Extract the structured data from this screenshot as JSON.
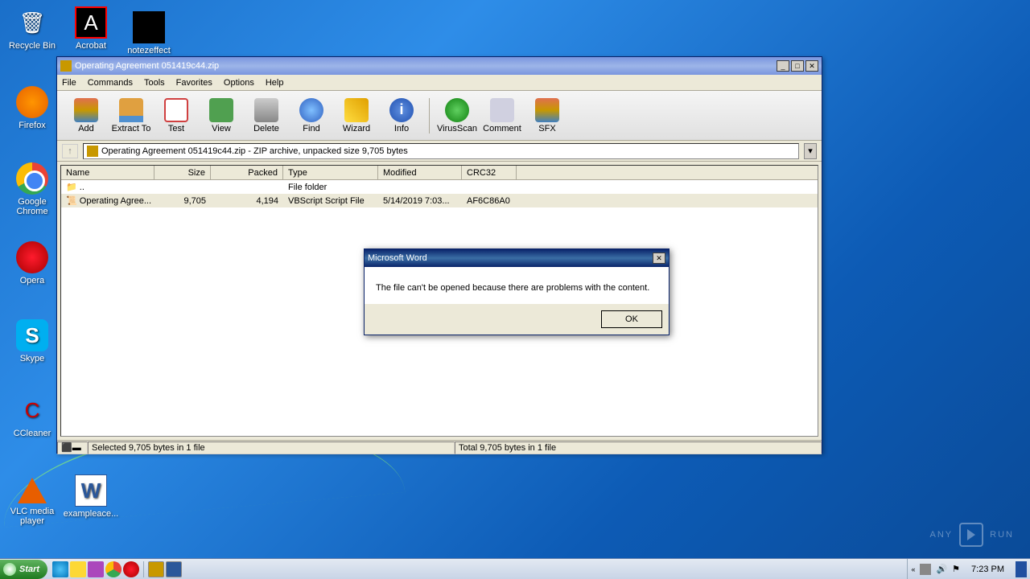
{
  "desktop": {
    "icons": {
      "recycle": "Recycle Bin",
      "acrobat": "Acrobat",
      "noteseffect": "notezeffect",
      "firefox": "Firefox",
      "chrome": "Google Chrome",
      "opera": "Opera",
      "skype": "Skype",
      "ccleaner": "CCleaner",
      "vlc": "VLC media player",
      "word": "exampleace..."
    }
  },
  "winrar": {
    "title": "Operating Agreement 051419c44.zip",
    "menu": [
      "File",
      "Commands",
      "Tools",
      "Favorites",
      "Options",
      "Help"
    ],
    "toolbar": {
      "add": "Add",
      "extract": "Extract To",
      "test": "Test",
      "view": "View",
      "delete": "Delete",
      "find": "Find",
      "wizard": "Wizard",
      "info": "Info",
      "virusscan": "VirusScan",
      "comment": "Comment",
      "sfx": "SFX"
    },
    "nav_path": "Operating Agreement 051419c44.zip - ZIP archive, unpacked size 9,705 bytes",
    "columns": {
      "name": "Name",
      "size": "Size",
      "packed": "Packed",
      "type": "Type",
      "modified": "Modified",
      "crc": "CRC32"
    },
    "rows": [
      {
        "name": "..",
        "size": "",
        "packed": "",
        "type": "File folder",
        "modified": "",
        "crc": ""
      },
      {
        "name": "Operating Agree...",
        "size": "9,705",
        "packed": "4,194",
        "type": "VBScript Script File",
        "modified": "5/14/2019 7:03...",
        "crc": "AF6C86A0"
      }
    ],
    "status_left": "Selected 9,705 bytes in 1 file",
    "status_right": "Total 9,705 bytes in 1 file"
  },
  "dialog": {
    "title": "Microsoft Word",
    "message": "The file can't be opened because there are problems with the content.",
    "ok": "OK"
  },
  "watermark": {
    "text": "ANY",
    "text2": "RUN"
  },
  "taskbar": {
    "start": "Start",
    "clock": "7:23 PM"
  }
}
